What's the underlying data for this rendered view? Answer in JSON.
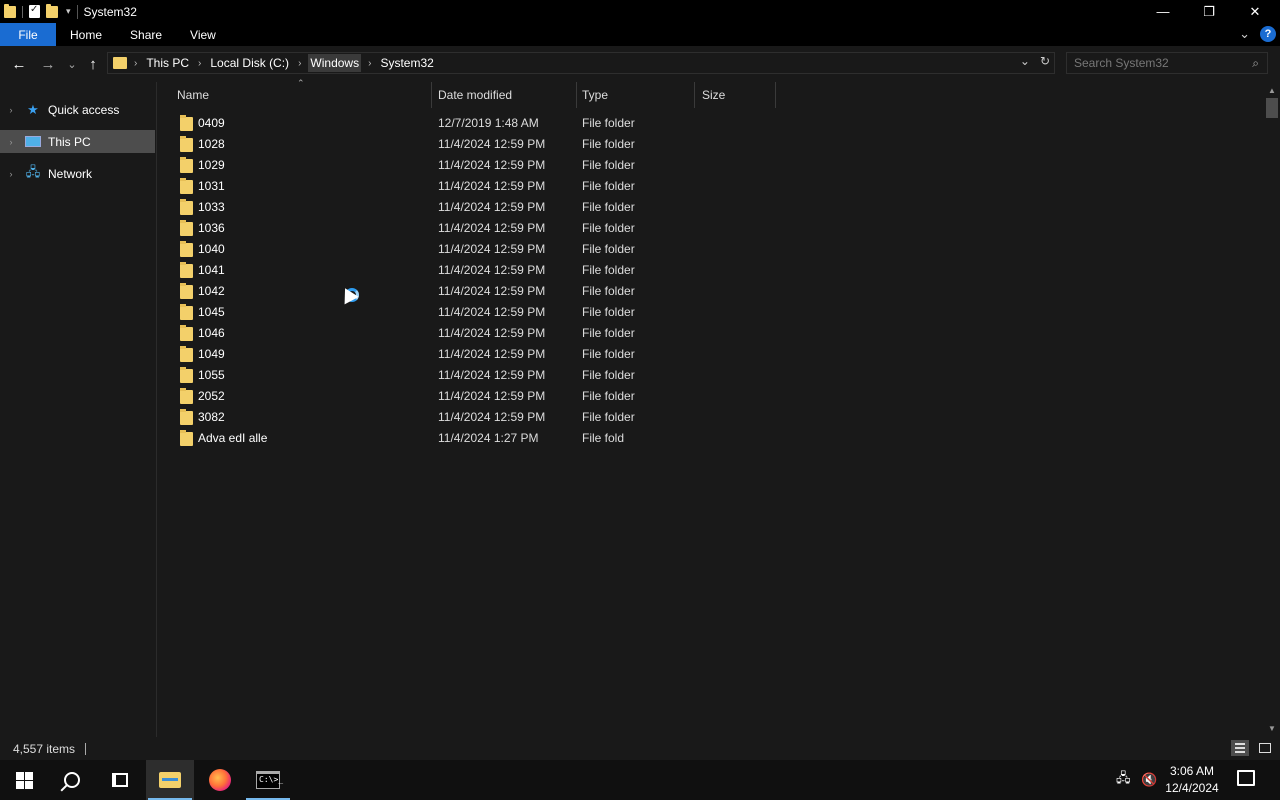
{
  "window": {
    "title": "System32",
    "minimize_glyph": "—",
    "restore_glyph": "❐",
    "close_glyph": "✕"
  },
  "ribbon": {
    "tabs": [
      {
        "label": "File"
      },
      {
        "label": "Home"
      },
      {
        "label": "Share"
      },
      {
        "label": "View"
      }
    ],
    "expand_glyph": "⌄",
    "help_glyph": "?"
  },
  "address": {
    "crumbs": [
      "This PC",
      "Local Disk (C:)",
      "Windows",
      "System32"
    ],
    "separator": "›",
    "dropdown_glyph": "⌄",
    "refresh_glyph": "↻"
  },
  "search": {
    "placeholder": "Search System32"
  },
  "navigation": {
    "back_glyph": "←",
    "forward_glyph": "→",
    "recent_glyph": "⌄",
    "up_glyph": "↑",
    "items": [
      {
        "label": "Quick access",
        "icon": "star-icon"
      },
      {
        "label": "This PC",
        "icon": "computer-icon"
      },
      {
        "label": "Network",
        "icon": "network-icon"
      }
    ]
  },
  "columns": {
    "name": "Name",
    "date": "Date modified",
    "type": "Type",
    "size": "Size"
  },
  "files": [
    {
      "name": "0409",
      "date": "12/7/2019 1:48 AM",
      "type": "File folder",
      "size": ""
    },
    {
      "name": "1028",
      "date": "11/4/2024 12:59 PM",
      "type": "File folder",
      "size": ""
    },
    {
      "name": "1029",
      "date": "11/4/2024 12:59 PM",
      "type": "File folder",
      "size": ""
    },
    {
      "name": "1031",
      "date": "11/4/2024 12:59 PM",
      "type": "File folder",
      "size": ""
    },
    {
      "name": "1033",
      "date": "11/4/2024 12:59 PM",
      "type": "File folder",
      "size": ""
    },
    {
      "name": "1036",
      "date": "11/4/2024 12:59 PM",
      "type": "File folder",
      "size": ""
    },
    {
      "name": "1040",
      "date": "11/4/2024 12:59 PM",
      "type": "File folder",
      "size": ""
    },
    {
      "name": "1041",
      "date": "11/4/2024 12:59 PM",
      "type": "File folder",
      "size": ""
    },
    {
      "name": "1042",
      "date": "11/4/2024 12:59 PM",
      "type": "File folder",
      "size": ""
    },
    {
      "name": "1045",
      "date": "11/4/2024 12:59 PM",
      "type": "File folder",
      "size": ""
    },
    {
      "name": "1046",
      "date": "11/4/2024 12:59 PM",
      "type": "File folder",
      "size": ""
    },
    {
      "name": "1049",
      "date": "11/4/2024 12:59 PM",
      "type": "File folder",
      "size": ""
    },
    {
      "name": "1055",
      "date": "11/4/2024 12:59 PM",
      "type": "File folder",
      "size": ""
    },
    {
      "name": "2052",
      "date": "11/4/2024 12:59 PM",
      "type": "File folder",
      "size": ""
    },
    {
      "name": "3082",
      "date": "11/4/2024 12:59 PM",
      "type": "File folder",
      "size": ""
    },
    {
      "name": "Adva   edI   alle",
      "date": "11/4/2024 1:27 PM",
      "type": "File fold",
      "size": ""
    }
  ],
  "status": {
    "item_count": "4,557 items"
  },
  "taskbar": {
    "apps": [
      "start",
      "search",
      "task-view",
      "file-explorer",
      "firefox",
      "command-prompt"
    ],
    "active_app": "file-explorer",
    "cmd_glyph": "C:\\>_"
  },
  "tray": {
    "time": "3:06 AM",
    "date": "12/4/2024",
    "network_glyph": "🖧",
    "volume_glyph": "🔇"
  },
  "colors": {
    "accent": "#1a6cd2",
    "background": "#191919",
    "folder": "#f3d06a",
    "selection": "#4d4d4d"
  }
}
